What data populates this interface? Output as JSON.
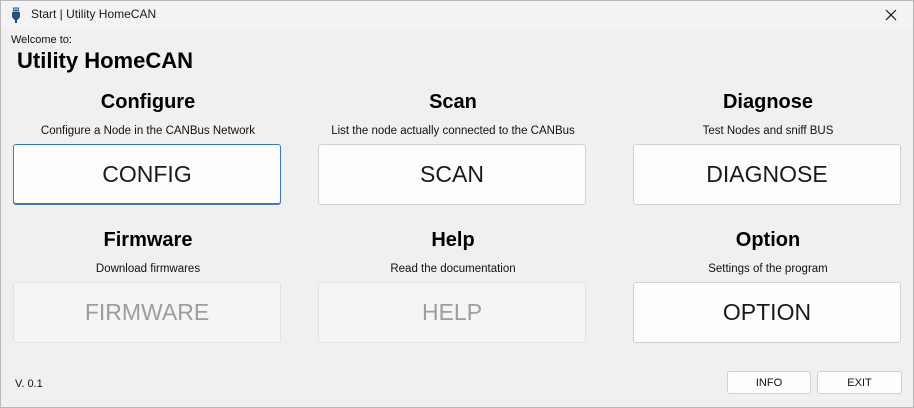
{
  "window": {
    "title": "Start | Utility HomeCAN"
  },
  "header": {
    "welcome": "Welcome to:",
    "app_name": "Utility HomeCAN"
  },
  "sections": [
    {
      "title": "Configure",
      "description": "Configure a Node in the CANBus Network",
      "button": "CONFIG",
      "state": "focused"
    },
    {
      "title": "Scan",
      "description": "List the node actually connected to the CANBus",
      "button": "SCAN",
      "state": "enabled"
    },
    {
      "title": "Diagnose",
      "description": "Test Nodes and sniff BUS",
      "button": "DIAGNOSE",
      "state": "enabled"
    },
    {
      "title": "Firmware",
      "description": "Download firmwares",
      "button": "FIRMWARE",
      "state": "disabled"
    },
    {
      "title": "Help",
      "description": "Read the documentation",
      "button": "HELP",
      "state": "disabled"
    },
    {
      "title": "Option",
      "description": "Settings of the program",
      "button": "OPTION",
      "state": "enabled"
    }
  ],
  "footer": {
    "version": "V. 0.1",
    "info_label": "INFO",
    "exit_label": "EXIT"
  },
  "colors": {
    "background": "#f0f0f0",
    "focus_border": "#3c78b4",
    "disabled_text": "#9d9d9d"
  },
  "icons": {
    "app_icon": "usb-plug-icon",
    "close": "close-icon"
  }
}
